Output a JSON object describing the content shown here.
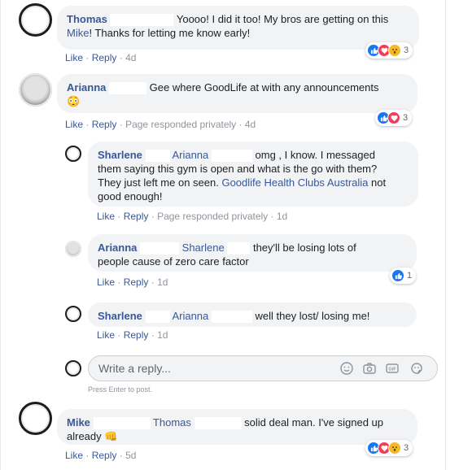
{
  "comments": [
    {
      "name": "Thomas",
      "text": "Yoooo! I did it too! My bros are getting on this ",
      "mention": "Mike",
      "text2": "! Thanks for letting me know early!",
      "like_label": "Like",
      "reply_label": "Reply",
      "time": "4d",
      "reaction_count": "3"
    },
    {
      "name": "Arianna",
      "text": "Gee where GoodLife at with any announcements",
      "emoji": "😳",
      "like_label": "Like",
      "reply_label": "Reply",
      "note": "Page responded privately",
      "time": "4d",
      "reaction_count": "3"
    },
    {
      "name": "Mike",
      "mention": "Thomas",
      "text": "solid deal man. I've signed up",
      "text2": "already",
      "emoji": "👊",
      "like_label": "Like",
      "reply_label": "Reply",
      "time": "5d",
      "reaction_count": "3"
    }
  ],
  "replies": [
    {
      "name": "Sharlene",
      "mention": "Arianna",
      "text": "omg , I know. I messaged",
      "text2": "them saying this gym is open and what is the go with them?",
      "text3": "They just left me on seen. ",
      "mention2": "Goodlife Health Clubs Australia",
      "text4": " not",
      "text5": "good enough!",
      "like_label": "Like",
      "reply_label": "Reply",
      "note": "Page responded privately",
      "time": "1d"
    },
    {
      "name": "Arianna",
      "mention": "Sharlene",
      "text": "they'll be losing lots of",
      "text2": "people cause of zero care factor",
      "like_label": "Like",
      "reply_label": "Reply",
      "time": "1d",
      "reaction_count": "1"
    },
    {
      "name": "Sharlene",
      "mention": "Arianna",
      "text": "well they lost/ losing me!",
      "like_label": "Like",
      "reply_label": "Reply",
      "time": "1d"
    }
  ],
  "reply_box": {
    "placeholder": "Write a reply...",
    "hint": "Press Enter to post.",
    "tools": [
      "emoji-icon",
      "camera-icon",
      "gif-icon",
      "sticker-icon"
    ]
  },
  "separators": {
    "dot": "·"
  },
  "colors": {
    "link": "#385898",
    "meta": "#90949c",
    "bubble": "#f2f3f5",
    "like": "#1877f2",
    "love": "#f33e58",
    "wow": "#f7b928"
  }
}
